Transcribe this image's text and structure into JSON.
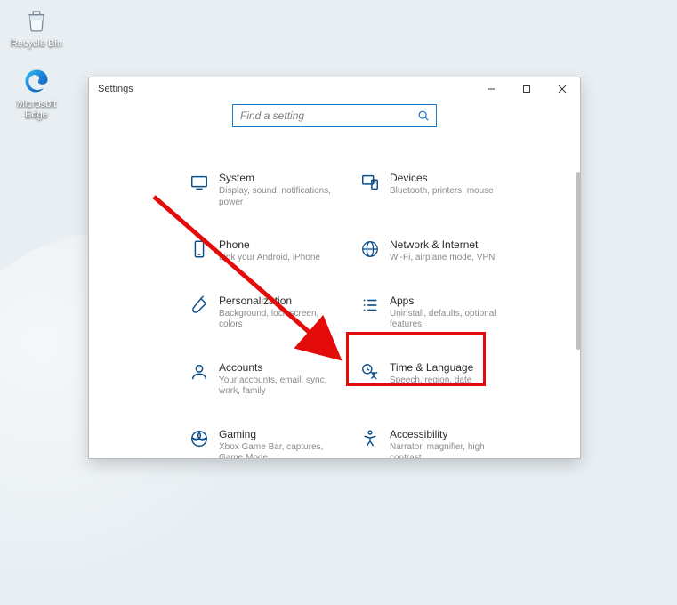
{
  "desktop": {
    "recycle_bin_label": "Recycle Bin",
    "edge_label": "Microsoft Edge"
  },
  "window": {
    "title": "Settings",
    "min_tooltip": "Minimize",
    "max_tooltip": "Maximize",
    "close_tooltip": "Close"
  },
  "search": {
    "placeholder": "Find a setting"
  },
  "cards": {
    "system": {
      "title": "System",
      "desc": "Display, sound, notifications, power"
    },
    "devices": {
      "title": "Devices",
      "desc": "Bluetooth, printers, mouse"
    },
    "phone": {
      "title": "Phone",
      "desc": "Link your Android, iPhone"
    },
    "network": {
      "title": "Network & Internet",
      "desc": "Wi-Fi, airplane mode, VPN"
    },
    "personalization": {
      "title": "Personalization",
      "desc": "Background, lock screen, colors"
    },
    "apps": {
      "title": "Apps",
      "desc": "Uninstall, defaults, optional features"
    },
    "accounts": {
      "title": "Accounts",
      "desc": "Your accounts, email, sync, work, family"
    },
    "time": {
      "title": "Time & Language",
      "desc": "Speech, region, date"
    },
    "gaming": {
      "title": "Gaming",
      "desc": "Xbox Game Bar, captures, Game Mode"
    },
    "accessibility": {
      "title": "Accessibility",
      "desc": "Narrator, magnifier, high contrast"
    }
  },
  "annotation": {
    "highlight_target": "time-language-card",
    "arrow_color": "#e40b0b"
  }
}
